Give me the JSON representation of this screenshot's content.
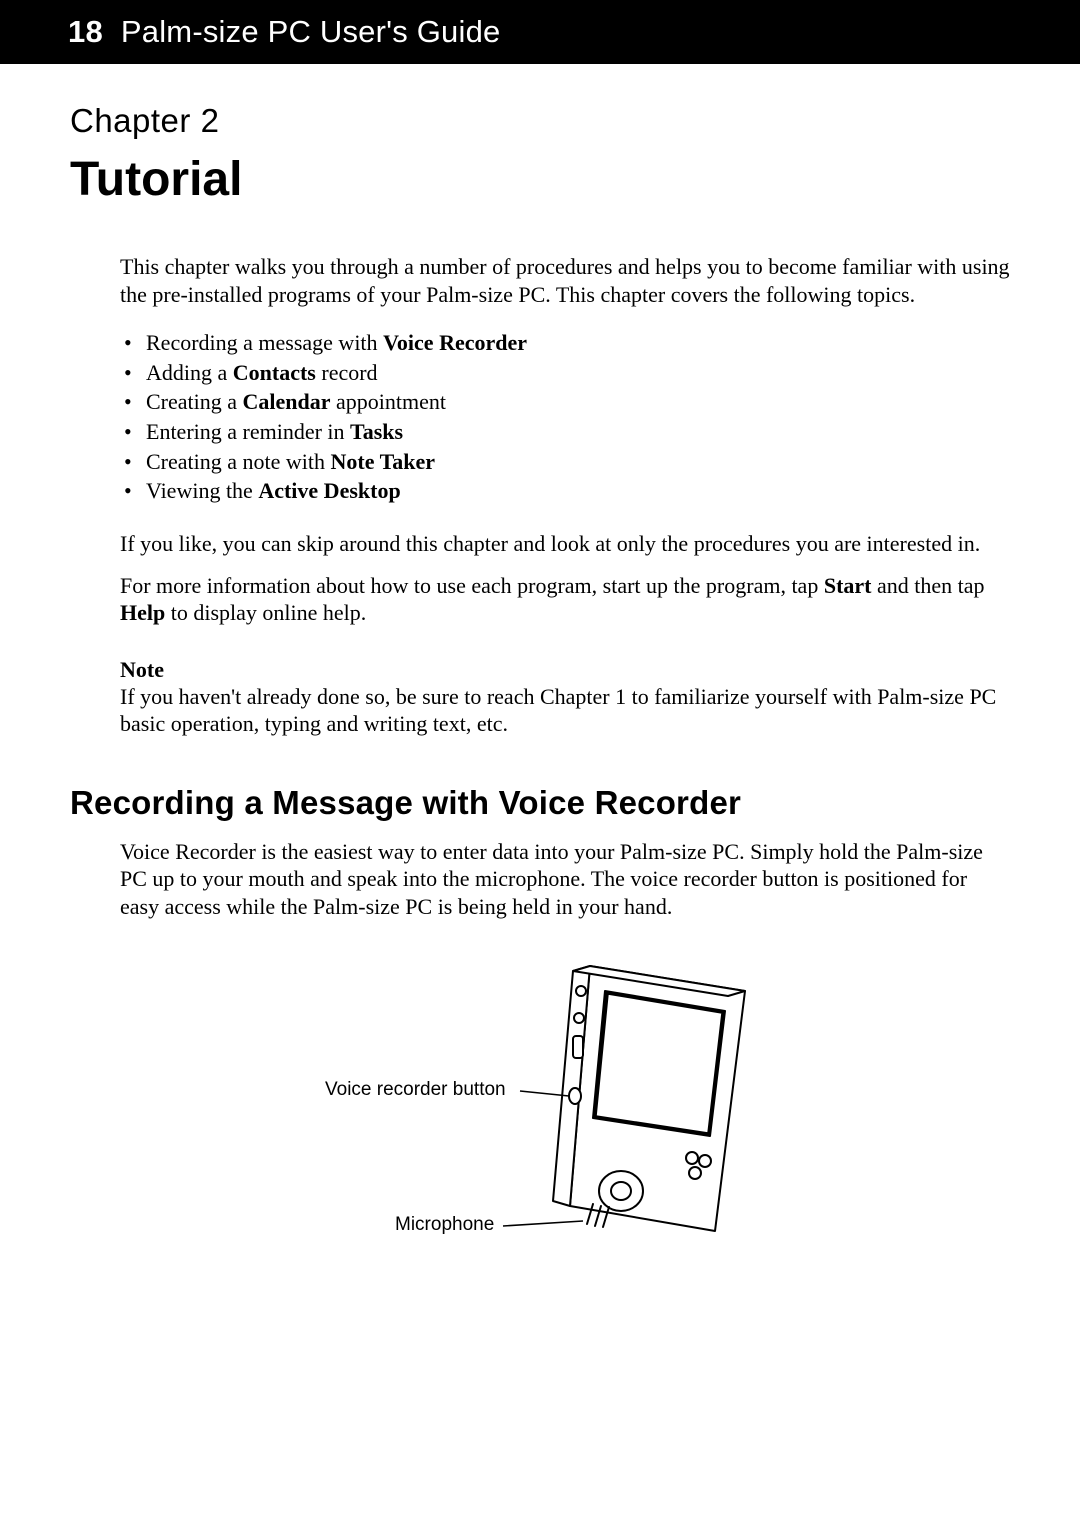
{
  "header": {
    "page_number": "18",
    "book_title": "Palm-size PC User's Guide"
  },
  "chapter": {
    "label": "Chapter 2",
    "title": "Tutorial"
  },
  "intro": {
    "para1": "This chapter walks you through a number of procedures and helps you to become familiar with using the pre-installed programs of your Palm-size PC. This chapter covers the following topics."
  },
  "topics": [
    {
      "prefix": "Recording a message with ",
      "bold": "Voice Recorder",
      "suffix": ""
    },
    {
      "prefix": "Adding a ",
      "bold": "Contacts",
      "suffix": " record"
    },
    {
      "prefix": "Creating a ",
      "bold": "Calendar",
      "suffix": " appointment"
    },
    {
      "prefix": "Entering a reminder in ",
      "bold": "Tasks",
      "suffix": ""
    },
    {
      "prefix": "Creating a note with ",
      "bold": "Note Taker",
      "suffix": ""
    },
    {
      "prefix": "Viewing the ",
      "bold": "Active Desktop",
      "suffix": ""
    }
  ],
  "skip_para": "If you like, you can skip around this chapter and look at only the procedures you are interested in.",
  "more_info": {
    "prefix": "For more information about how to use each program, start up the program, tap ",
    "bold1": "Start",
    "mid": " and then tap ",
    "bold2": "Help",
    "suffix": " to display online help."
  },
  "note": {
    "heading": "Note",
    "body": "If you haven't already done so, be sure to reach Chapter 1 to familiarize yourself with Palm-size PC basic operation, typing and writing text, etc."
  },
  "section": {
    "heading": "Recording a Message with Voice Recorder",
    "para": "Voice Recorder is the easiest way to enter data into your Palm-size PC. Simply hold the Palm-size PC up to your mouth and speak into the microphone. The voice recorder button is positioned for easy access while the Palm-size PC is being held in your hand."
  },
  "figure": {
    "callout1": "Voice recorder button",
    "callout2": "Microphone"
  }
}
